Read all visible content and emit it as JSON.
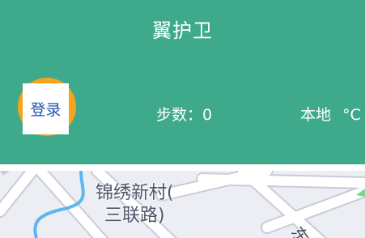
{
  "header": {
    "title": "翼护卫",
    "login_label": "登录",
    "steps_label": "步数：",
    "steps_value": "0",
    "location": "本地",
    "temp_unit": "°C"
  },
  "map": {
    "place_name_line1": "锦绣新村(",
    "place_name_line2": "三联路)",
    "road_label": "东"
  },
  "colors": {
    "header_bg": "#3fa98c",
    "avatar_bg": "#f5a41b",
    "login_text": "#2454b3",
    "map_bg": "#eceef4",
    "water": "#5bb8ee"
  }
}
